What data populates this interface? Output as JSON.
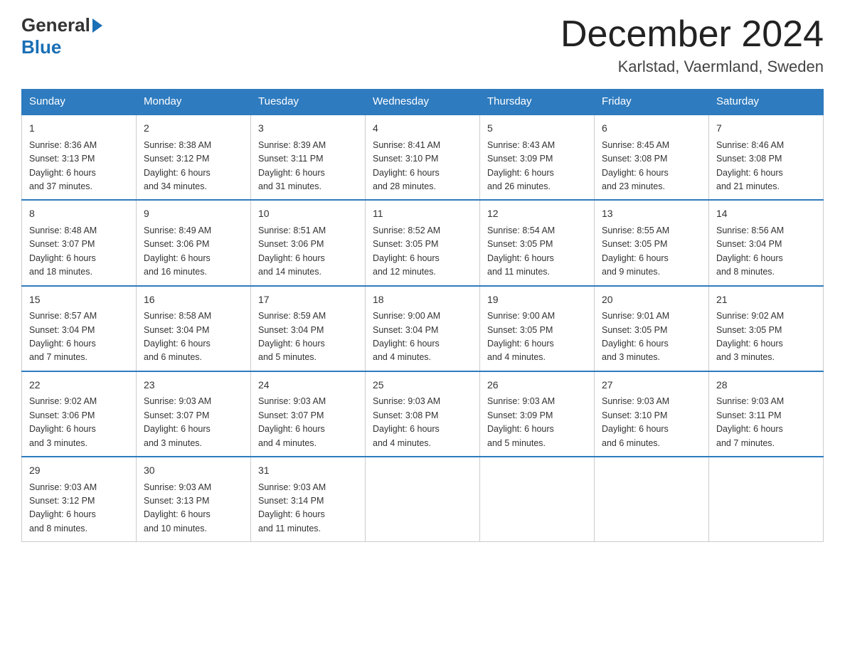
{
  "header": {
    "logo_general": "General",
    "logo_blue": "Blue",
    "month_title": "December 2024",
    "location": "Karlstad, Vaermland, Sweden"
  },
  "weekdays": [
    "Sunday",
    "Monday",
    "Tuesday",
    "Wednesday",
    "Thursday",
    "Friday",
    "Saturday"
  ],
  "weeks": [
    [
      {
        "day": "1",
        "sunrise": "8:36 AM",
        "sunset": "3:13 PM",
        "daylight": "6 hours and 37 minutes."
      },
      {
        "day": "2",
        "sunrise": "8:38 AM",
        "sunset": "3:12 PM",
        "daylight": "6 hours and 34 minutes."
      },
      {
        "day": "3",
        "sunrise": "8:39 AM",
        "sunset": "3:11 PM",
        "daylight": "6 hours and 31 minutes."
      },
      {
        "day": "4",
        "sunrise": "8:41 AM",
        "sunset": "3:10 PM",
        "daylight": "6 hours and 28 minutes."
      },
      {
        "day": "5",
        "sunrise": "8:43 AM",
        "sunset": "3:09 PM",
        "daylight": "6 hours and 26 minutes."
      },
      {
        "day": "6",
        "sunrise": "8:45 AM",
        "sunset": "3:08 PM",
        "daylight": "6 hours and 23 minutes."
      },
      {
        "day": "7",
        "sunrise": "8:46 AM",
        "sunset": "3:08 PM",
        "daylight": "6 hours and 21 minutes."
      }
    ],
    [
      {
        "day": "8",
        "sunrise": "8:48 AM",
        "sunset": "3:07 PM",
        "daylight": "6 hours and 18 minutes."
      },
      {
        "day": "9",
        "sunrise": "8:49 AM",
        "sunset": "3:06 PM",
        "daylight": "6 hours and 16 minutes."
      },
      {
        "day": "10",
        "sunrise": "8:51 AM",
        "sunset": "3:06 PM",
        "daylight": "6 hours and 14 minutes."
      },
      {
        "day": "11",
        "sunrise": "8:52 AM",
        "sunset": "3:05 PM",
        "daylight": "6 hours and 12 minutes."
      },
      {
        "day": "12",
        "sunrise": "8:54 AM",
        "sunset": "3:05 PM",
        "daylight": "6 hours and 11 minutes."
      },
      {
        "day": "13",
        "sunrise": "8:55 AM",
        "sunset": "3:05 PM",
        "daylight": "6 hours and 9 minutes."
      },
      {
        "day": "14",
        "sunrise": "8:56 AM",
        "sunset": "3:04 PM",
        "daylight": "6 hours and 8 minutes."
      }
    ],
    [
      {
        "day": "15",
        "sunrise": "8:57 AM",
        "sunset": "3:04 PM",
        "daylight": "6 hours and 7 minutes."
      },
      {
        "day": "16",
        "sunrise": "8:58 AM",
        "sunset": "3:04 PM",
        "daylight": "6 hours and 6 minutes."
      },
      {
        "day": "17",
        "sunrise": "8:59 AM",
        "sunset": "3:04 PM",
        "daylight": "6 hours and 5 minutes."
      },
      {
        "day": "18",
        "sunrise": "9:00 AM",
        "sunset": "3:04 PM",
        "daylight": "6 hours and 4 minutes."
      },
      {
        "day": "19",
        "sunrise": "9:00 AM",
        "sunset": "3:05 PM",
        "daylight": "6 hours and 4 minutes."
      },
      {
        "day": "20",
        "sunrise": "9:01 AM",
        "sunset": "3:05 PM",
        "daylight": "6 hours and 3 minutes."
      },
      {
        "day": "21",
        "sunrise": "9:02 AM",
        "sunset": "3:05 PM",
        "daylight": "6 hours and 3 minutes."
      }
    ],
    [
      {
        "day": "22",
        "sunrise": "9:02 AM",
        "sunset": "3:06 PM",
        "daylight": "6 hours and 3 minutes."
      },
      {
        "day": "23",
        "sunrise": "9:03 AM",
        "sunset": "3:07 PM",
        "daylight": "6 hours and 3 minutes."
      },
      {
        "day": "24",
        "sunrise": "9:03 AM",
        "sunset": "3:07 PM",
        "daylight": "6 hours and 4 minutes."
      },
      {
        "day": "25",
        "sunrise": "9:03 AM",
        "sunset": "3:08 PM",
        "daylight": "6 hours and 4 minutes."
      },
      {
        "day": "26",
        "sunrise": "9:03 AM",
        "sunset": "3:09 PM",
        "daylight": "6 hours and 5 minutes."
      },
      {
        "day": "27",
        "sunrise": "9:03 AM",
        "sunset": "3:10 PM",
        "daylight": "6 hours and 6 minutes."
      },
      {
        "day": "28",
        "sunrise": "9:03 AM",
        "sunset": "3:11 PM",
        "daylight": "6 hours and 7 minutes."
      }
    ],
    [
      {
        "day": "29",
        "sunrise": "9:03 AM",
        "sunset": "3:12 PM",
        "daylight": "6 hours and 8 minutes."
      },
      {
        "day": "30",
        "sunrise": "9:03 AM",
        "sunset": "3:13 PM",
        "daylight": "6 hours and 10 minutes."
      },
      {
        "day": "31",
        "sunrise": "9:03 AM",
        "sunset": "3:14 PM",
        "daylight": "6 hours and 11 minutes."
      },
      null,
      null,
      null,
      null
    ]
  ],
  "labels": {
    "sunrise": "Sunrise:",
    "sunset": "Sunset:",
    "daylight": "Daylight:"
  }
}
